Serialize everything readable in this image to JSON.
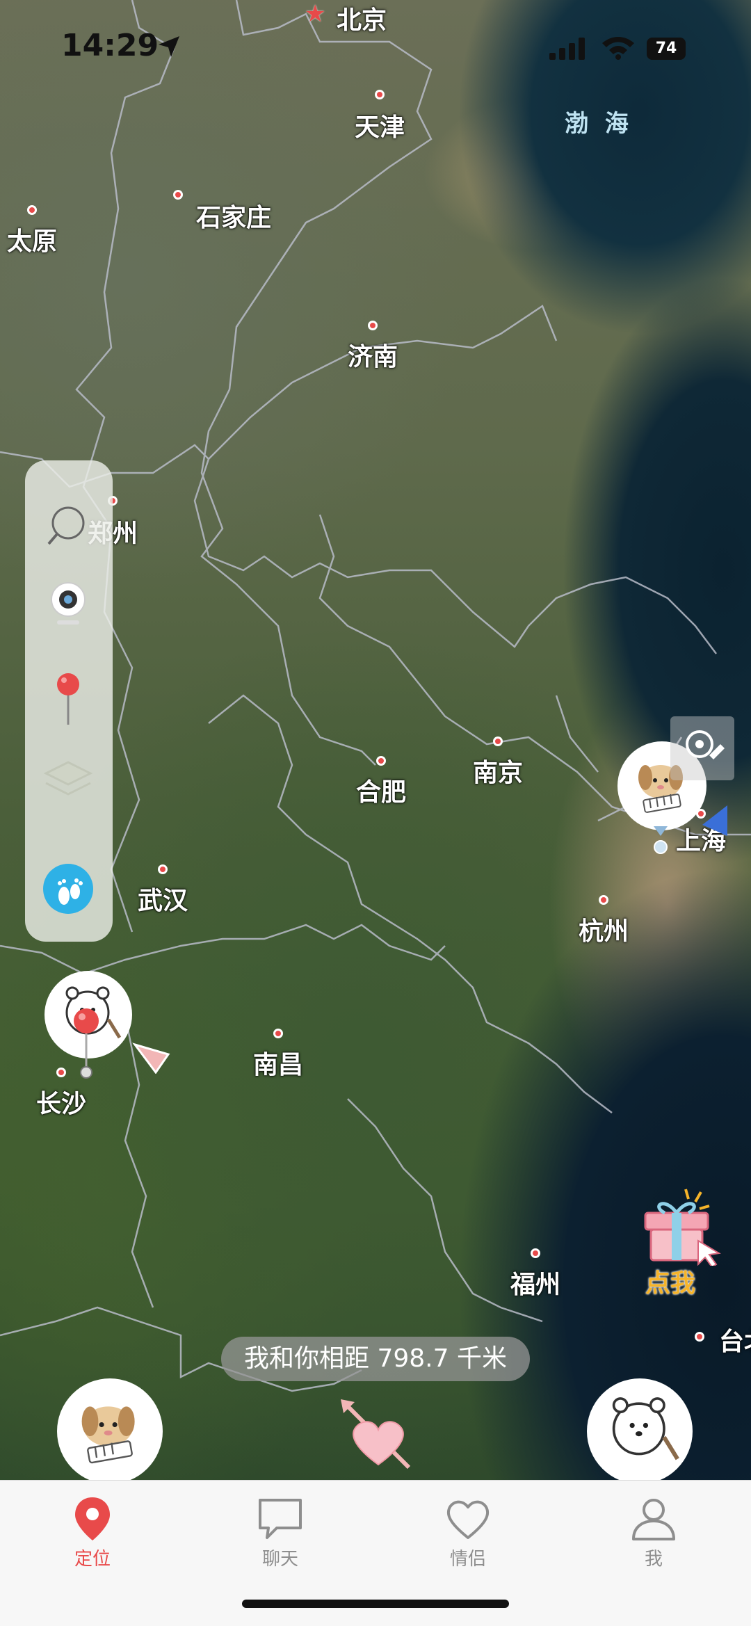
{
  "status": {
    "time": "14:29",
    "battery": "74"
  },
  "map": {
    "cities": [
      {
        "id": "beijing",
        "name": "北京",
        "capital": true
      },
      {
        "id": "tianjin",
        "name": "天津"
      },
      {
        "id": "shijiazhuang",
        "name": "石家庄"
      },
      {
        "id": "taiyuan",
        "name": "太原"
      },
      {
        "id": "jinan",
        "name": "济南"
      },
      {
        "id": "zhengzhou",
        "name": "郑州"
      },
      {
        "id": "hefei",
        "name": "合肥"
      },
      {
        "id": "nanjing",
        "name": "南京"
      },
      {
        "id": "shanghai",
        "name": "上海"
      },
      {
        "id": "wuhan",
        "name": "武汉"
      },
      {
        "id": "hangzhou",
        "name": "杭州"
      },
      {
        "id": "changsha",
        "name": "长沙"
      },
      {
        "id": "nanchang",
        "name": "南昌"
      },
      {
        "id": "fuzhou",
        "name": "福州"
      },
      {
        "id": "taibei",
        "name": "台北"
      }
    ],
    "sea_label": "渤 海"
  },
  "toolbar": {
    "items": [
      "search-icon",
      "camera-icon",
      "pin-icon",
      "layers-icon",
      "footprint-icon"
    ]
  },
  "gift": {
    "label": "点我"
  },
  "distance_text": "我和你相距 798.7 千米",
  "tabs": [
    {
      "label": "定位",
      "icon": "location-icon",
      "active": true
    },
    {
      "label": "聊天",
      "icon": "chat-icon",
      "active": false
    },
    {
      "label": "情侣",
      "icon": "heart-icon",
      "active": false
    },
    {
      "label": "我",
      "icon": "profile-icon",
      "active": false
    }
  ],
  "colors": {
    "accent": "#e84a4a",
    "tab_inactive": "#8e8e8e",
    "footprint": "#2eb1e6"
  }
}
